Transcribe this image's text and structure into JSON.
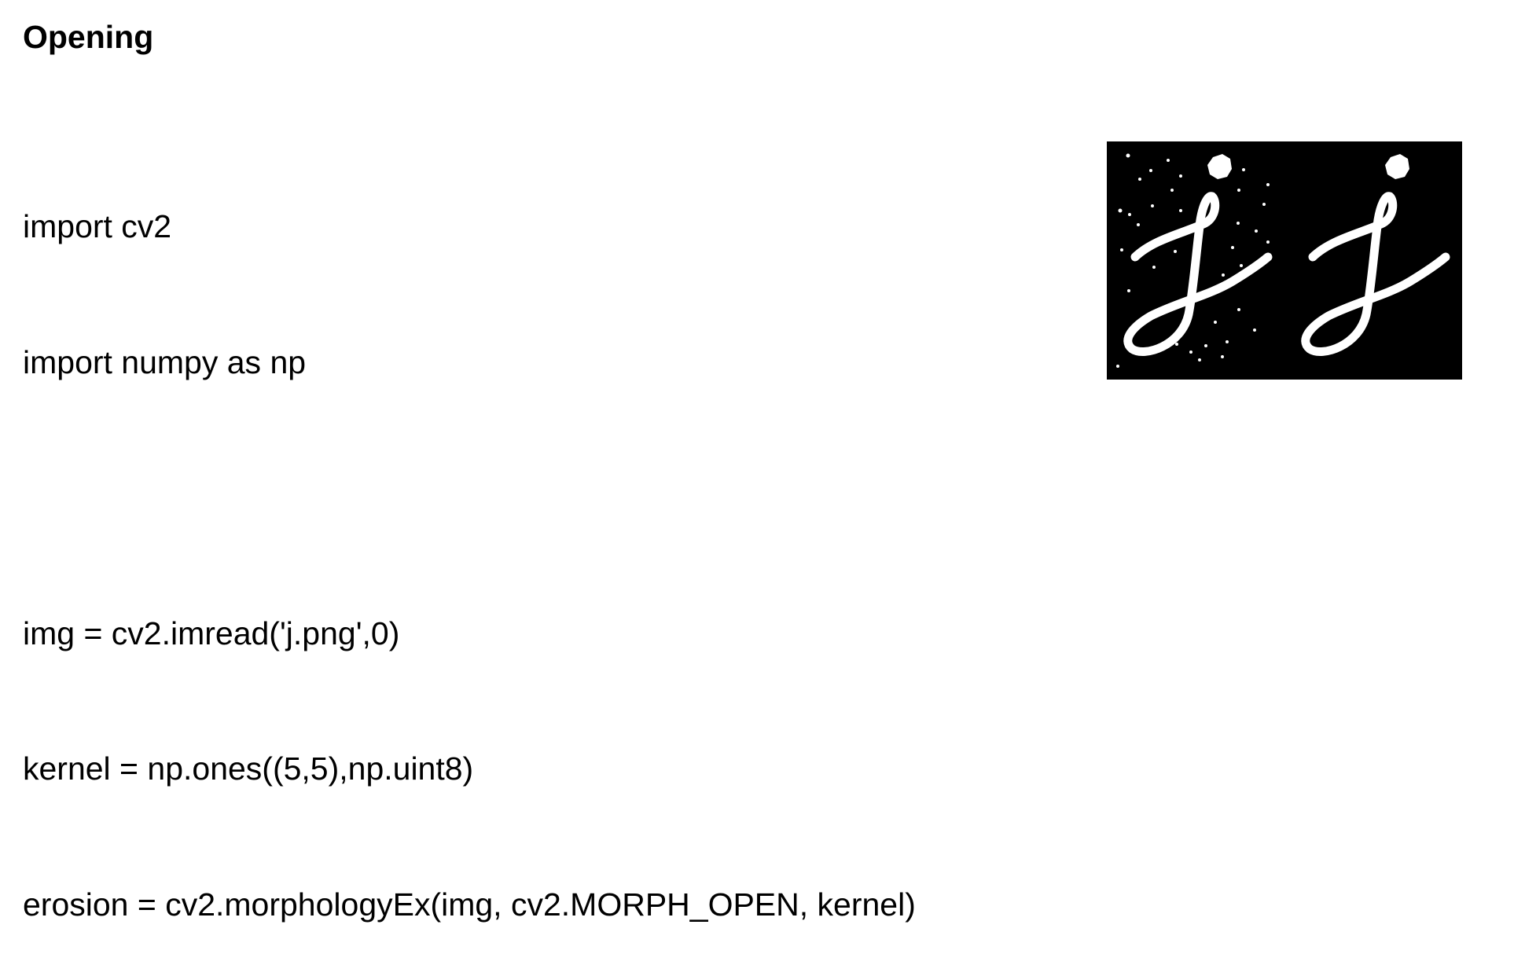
{
  "slide": {
    "title": "Opening",
    "code_lines": [
      "import cv2",
      "import numpy as np",
      "",
      "img = cv2.imread('j.png',0)",
      "kernel = np.ones((5,5),np.uint8)",
      "erosion = cv2.morphologyEx(img, cv2.MORPH_OPEN, kernel)"
    ]
  },
  "figure": {
    "background": "#000000",
    "foreground": "#ffffff",
    "panels": [
      "noisy-input",
      "opened-output"
    ]
  }
}
